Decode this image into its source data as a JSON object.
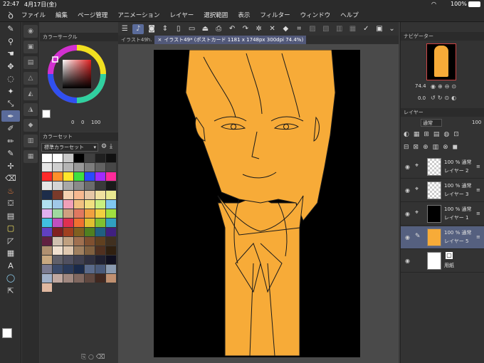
{
  "status": {
    "time": "22:47",
    "date": "4月17日(金)",
    "battery": "100%"
  },
  "menu": [
    "ファイル",
    "編集",
    "ページ管理",
    "アニメーション",
    "レイヤー",
    "選択範囲",
    "表示",
    "フィルター",
    "ウィンドウ",
    "ヘルプ"
  ],
  "tabs": {
    "inactive": "イラスト49h.",
    "active": "イラスト49* (ポストカード 1181 x 1748px 300dpi 74.4%)"
  },
  "panels": {
    "color_circle": "カラーサークル",
    "color_set": "カラーセット",
    "color_set_name": "標準カラーセット",
    "navigator": "ナビゲーター",
    "layer": "レイヤー"
  },
  "navigator": {
    "zoom": "74.4",
    "rotation": "0.0"
  },
  "layer_panel": {
    "blend": "通常",
    "opacity": "100"
  },
  "color_values": {
    "v1": "0",
    "v2": "0",
    "v3": "100"
  },
  "layers": [
    {
      "line1": "100 % 通常",
      "line2": "レイヤー 2",
      "selected": false
    },
    {
      "line1": "100 % 通常",
      "line2": "レイヤー 3",
      "selected": false
    },
    {
      "line1": "100 % 通常",
      "line2": "レイヤー 1",
      "selected": false
    },
    {
      "line1": "100 % 通常",
      "line2": "レイヤー 5",
      "selected": true
    },
    {
      "line1": "",
      "line2": "用紙",
      "selected": false
    }
  ],
  "colors": {
    "accent": "#5a6b9a",
    "hair_fill": "#f7ab38",
    "canvas_bg": "#000000",
    "selected_layer": "#55607f"
  },
  "swatches": [
    "#ffffff",
    "#ffffff",
    "#c8c8c8",
    "#000000",
    "#404040",
    "#202020",
    "#111111",
    "#e6e6e6",
    "#cfcfcf",
    "#b4b4b4",
    "#999999",
    "#7d7d7d",
    "#626262",
    "#474747",
    "#ff2a2a",
    "#ff8f2a",
    "#ffe62a",
    "#3fe03f",
    "#2a4aff",
    "#a02aff",
    "#ff2a9a",
    "#e6e6e6",
    "#d4d4d4",
    "#a8a8a8",
    "#8a8a8a",
    "#6c6c6c",
    "#3a3a3a",
    "#1a1a1a",
    "#1d2d4a",
    "#7a3a2a",
    "#f4d0b0",
    "#f7b890",
    "#e6c6a6",
    "#f0e0a0",
    "#e8e890",
    "#b0e0f0",
    "#a0c8e8",
    "#f0a0b8",
    "#f0c080",
    "#f0e080",
    "#c8f080",
    "#80c8f0",
    "#e0b0f0",
    "#a0d8a0",
    "#d0a080",
    "#e07860",
    "#f0a040",
    "#f0d040",
    "#a0e040",
    "#40c0e0",
    "#c050c0",
    "#e03050",
    "#f07030",
    "#e0c030",
    "#80c030",
    "#30a0c0",
    "#6040c0",
    "#802020",
    "#a04020",
    "#806020",
    "#508020",
    "#206080",
    "#402080",
    "#602040",
    "#d0c0b0",
    "#c0a080",
    "#a07050",
    "#805030",
    "#604020",
    "#403020",
    "#b09070",
    "#f0e0d0",
    "#e0c8b0",
    "#a08060",
    "#806040",
    "#503020",
    "#302010",
    "#c8a880",
    "#60606a",
    "#505060",
    "#404050",
    "#303040",
    "#202030",
    "#101020",
    "#7a7a90",
    "#3a4a6a",
    "#2a3a5a",
    "#1a2a4a",
    "#5a6a8a",
    "#4a5a7a",
    "#8a9ab0",
    "#a0b0c8",
    "#c0a8a0",
    "#a08880",
    "#806860",
    "#604840",
    "#402820",
    "#c09070",
    "#e0b8a0"
  ],
  "tool_icons": [
    "pen-icon",
    "zoom-icon",
    "hand-icon",
    "move-icon",
    "lasso-icon",
    "magic-wand-icon",
    "eyedropper-icon",
    "brush-icon",
    "pen-tool-icon",
    "pencil-icon",
    "airbrush-icon",
    "decoration-icon",
    "eraser-icon",
    "blend-icon",
    "fill-icon",
    "gradient-icon",
    "figure-icon",
    "frame-icon",
    "ruler-icon",
    "text-icon",
    "balloon-icon",
    "correct-line-icon",
    "color-swatch-icon"
  ]
}
